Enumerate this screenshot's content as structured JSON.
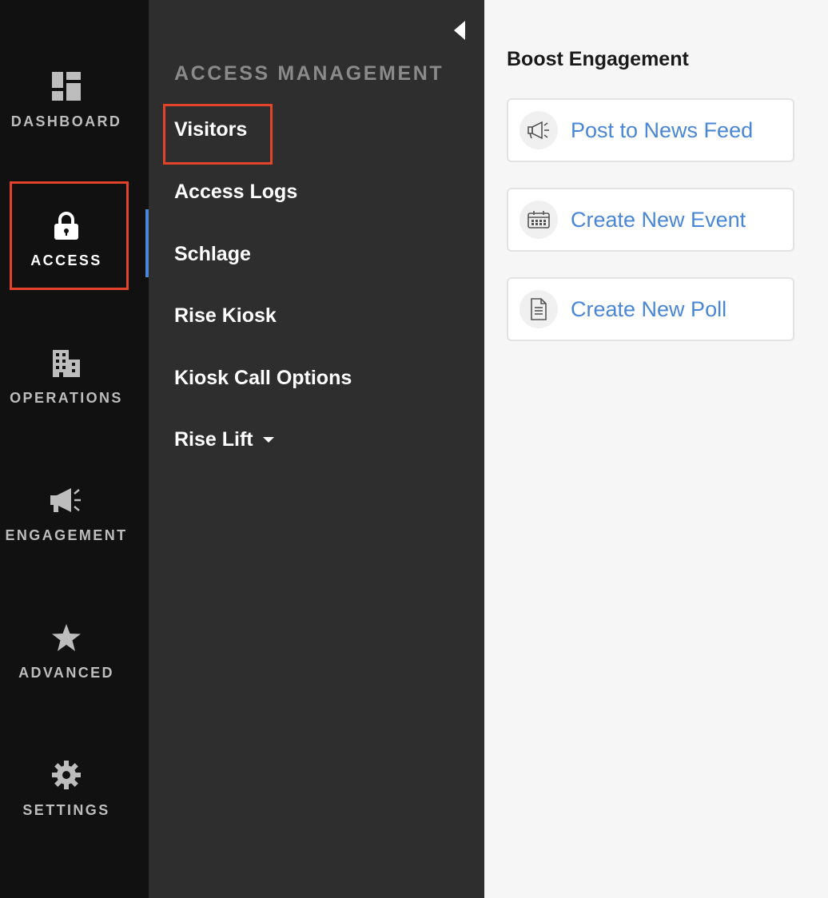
{
  "rail": {
    "items": [
      {
        "label": "DASHBOARD",
        "icon": "dashboard-icon"
      },
      {
        "label": "ACCESS",
        "icon": "lock-icon",
        "active": true
      },
      {
        "label": "OPERATIONS",
        "icon": "building-icon"
      },
      {
        "label": "ENGAGEMENT",
        "icon": "megaphone-icon"
      },
      {
        "label": "ADVANCED",
        "icon": "star-icon"
      },
      {
        "label": "SETTINGS",
        "icon": "gear-icon"
      }
    ]
  },
  "submenu": {
    "title": "ACCESS MANAGEMENT",
    "items": [
      {
        "label": "Visitors"
      },
      {
        "label": "Access Logs"
      },
      {
        "label": "Schlage"
      },
      {
        "label": "Rise Kiosk"
      },
      {
        "label": "Kiosk Call Options"
      },
      {
        "label": "Rise Lift",
        "has_dropdown": true
      }
    ]
  },
  "main": {
    "title": "Boost Engagement",
    "cards": [
      {
        "label": "Post to News Feed",
        "icon": "megaphone-icon"
      },
      {
        "label": "Create New Event",
        "icon": "calendar-icon"
      },
      {
        "label": "Create New Poll",
        "icon": "document-icon"
      }
    ]
  },
  "colors": {
    "rail_bg": "#111111",
    "submenu_bg": "#2e2e2e",
    "main_bg": "#f6f6f6",
    "accent_blue": "#4a86d6",
    "highlight_red": "#e3432a"
  }
}
